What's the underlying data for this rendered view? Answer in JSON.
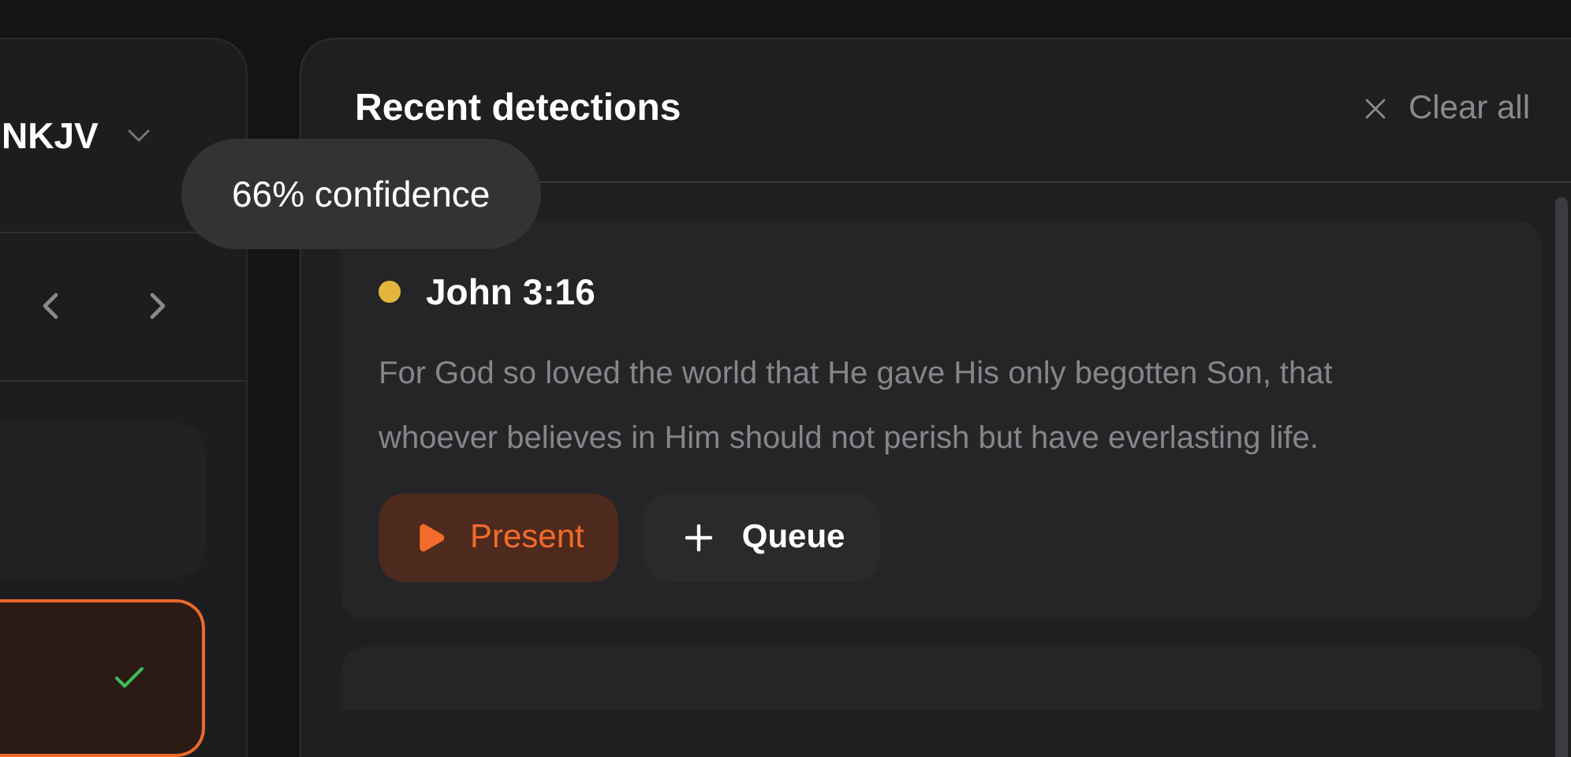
{
  "version_picker": {
    "label": "NKJV"
  },
  "slides": [
    {
      "selected": false,
      "done": false
    },
    {
      "selected": true,
      "done": true
    }
  ],
  "tooltip": {
    "text": "66% confidence"
  },
  "detections_panel": {
    "title": "Recent detections",
    "clear_label": "Clear all",
    "items": [
      {
        "reference": "John 3:16",
        "color": "#e3b53a",
        "text": "For God so loved the world that He gave His only begotten Son, that whoever believes in Him should not perish but have everlasting life.",
        "present_label": "Present",
        "queue_label": "Queue"
      }
    ]
  }
}
